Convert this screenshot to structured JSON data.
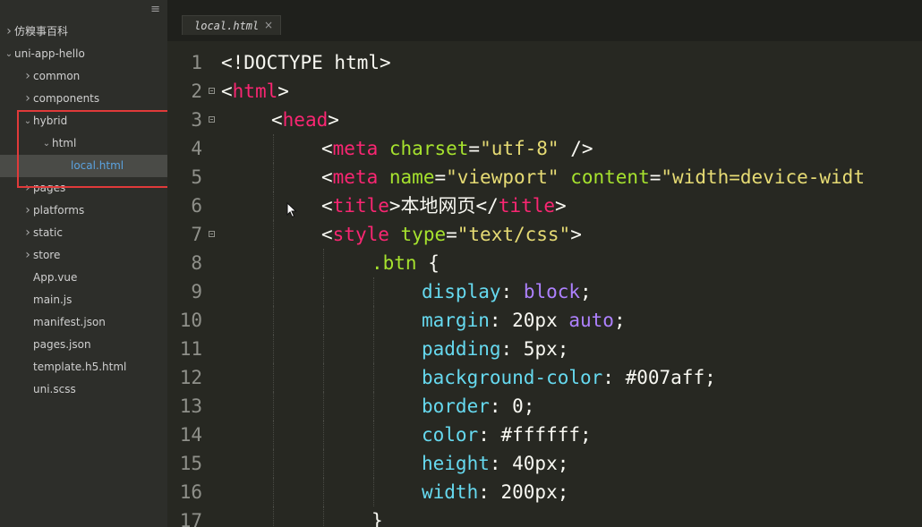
{
  "sidebar": {
    "menu_glyph": "≡",
    "items": [
      {
        "label": "仿糗事百科",
        "depth": 0,
        "chevron": "right"
      },
      {
        "label": "uni-app-hello",
        "depth": 0,
        "chevron": "down"
      },
      {
        "label": "common",
        "depth": 1,
        "chevron": "right"
      },
      {
        "label": "components",
        "depth": 1,
        "chevron": "right"
      },
      {
        "label": "hybrid",
        "depth": 1,
        "chevron": "down"
      },
      {
        "label": "html",
        "depth": 2,
        "chevron": "down"
      },
      {
        "label": "local.html",
        "depth": 3,
        "chevron": "none",
        "selected": true
      },
      {
        "label": "pages",
        "depth": 1,
        "chevron": "right"
      },
      {
        "label": "platforms",
        "depth": 1,
        "chevron": "right"
      },
      {
        "label": "static",
        "depth": 1,
        "chevron": "right"
      },
      {
        "label": "store",
        "depth": 1,
        "chevron": "right"
      },
      {
        "label": "App.vue",
        "depth": 1,
        "chevron": "none"
      },
      {
        "label": "main.js",
        "depth": 1,
        "chevron": "none"
      },
      {
        "label": "manifest.json",
        "depth": 1,
        "chevron": "none"
      },
      {
        "label": "pages.json",
        "depth": 1,
        "chevron": "none"
      },
      {
        "label": "template.h5.html",
        "depth": 1,
        "chevron": "none"
      },
      {
        "label": "uni.scss",
        "depth": 1,
        "chevron": "none"
      }
    ]
  },
  "tab": {
    "label": "local.html",
    "close": "×"
  },
  "editor": {
    "lines": [
      {
        "n": "1",
        "fold": false,
        "indent": 0,
        "tokens": [
          [
            "punc",
            "<!DOCTYPE html>"
          ]
        ]
      },
      {
        "n": "2",
        "fold": true,
        "indent": 0,
        "tokens": [
          [
            "punc",
            "<"
          ],
          [
            "tag",
            "html"
          ],
          [
            "punc",
            ">"
          ]
        ]
      },
      {
        "n": "3",
        "fold": true,
        "indent": 1,
        "tokens": [
          [
            "punc",
            "<"
          ],
          [
            "tag",
            "head"
          ],
          [
            "punc",
            ">"
          ]
        ]
      },
      {
        "n": "4",
        "fold": false,
        "indent": 2,
        "tokens": [
          [
            "punc",
            "<"
          ],
          [
            "tag",
            "meta"
          ],
          [
            "punc",
            " "
          ],
          [
            "attr",
            "charset"
          ],
          [
            "punc",
            "="
          ],
          [
            "str",
            "\"utf-8\""
          ],
          [
            "punc",
            " />"
          ]
        ]
      },
      {
        "n": "5",
        "fold": false,
        "indent": 2,
        "tokens": [
          [
            "punc",
            "<"
          ],
          [
            "tag",
            "meta"
          ],
          [
            "punc",
            " "
          ],
          [
            "attr",
            "name"
          ],
          [
            "punc",
            "="
          ],
          [
            "str",
            "\"viewport\""
          ],
          [
            "punc",
            " "
          ],
          [
            "attr",
            "content"
          ],
          [
            "punc",
            "="
          ],
          [
            "str",
            "\"width=device-widt"
          ]
        ]
      },
      {
        "n": "6",
        "fold": false,
        "indent": 2,
        "tokens": [
          [
            "punc",
            "<"
          ],
          [
            "tag",
            "title"
          ],
          [
            "punc",
            ">"
          ],
          [
            "text",
            "本地网页"
          ],
          [
            "punc",
            "</"
          ],
          [
            "tag",
            "title"
          ],
          [
            "punc",
            ">"
          ]
        ]
      },
      {
        "n": "7",
        "fold": true,
        "indent": 2,
        "tokens": [
          [
            "punc",
            "<"
          ],
          [
            "tag",
            "style"
          ],
          [
            "punc",
            " "
          ],
          [
            "attr",
            "type"
          ],
          [
            "punc",
            "="
          ],
          [
            "str",
            "\"text/css\""
          ],
          [
            "punc",
            ">"
          ]
        ]
      },
      {
        "n": "8",
        "fold": false,
        "indent": 3,
        "tokens": [
          [
            "attr",
            ".btn"
          ],
          [
            "punc",
            " {"
          ]
        ]
      },
      {
        "n": "9",
        "fold": false,
        "indent": 4,
        "tokens": [
          [
            "prop",
            "display"
          ],
          [
            "punc",
            ": "
          ],
          [
            "kw",
            "block"
          ],
          [
            "punc",
            ";"
          ]
        ]
      },
      {
        "n": "10",
        "fold": false,
        "indent": 4,
        "tokens": [
          [
            "prop",
            "margin"
          ],
          [
            "punc",
            ": 20px "
          ],
          [
            "kw",
            "auto"
          ],
          [
            "punc",
            ";"
          ]
        ]
      },
      {
        "n": "11",
        "fold": false,
        "indent": 4,
        "tokens": [
          [
            "prop",
            "padding"
          ],
          [
            "punc",
            ": 5px;"
          ]
        ]
      },
      {
        "n": "12",
        "fold": false,
        "indent": 4,
        "tokens": [
          [
            "prop",
            "background-color"
          ],
          [
            "punc",
            ": #007aff;"
          ]
        ]
      },
      {
        "n": "13",
        "fold": false,
        "indent": 4,
        "tokens": [
          [
            "prop",
            "border"
          ],
          [
            "punc",
            ": 0;"
          ]
        ]
      },
      {
        "n": "14",
        "fold": false,
        "indent": 4,
        "tokens": [
          [
            "prop",
            "color"
          ],
          [
            "punc",
            ": #ffffff;"
          ]
        ]
      },
      {
        "n": "15",
        "fold": false,
        "indent": 4,
        "tokens": [
          [
            "prop",
            "height"
          ],
          [
            "punc",
            ": 40px;"
          ]
        ]
      },
      {
        "n": "16",
        "fold": false,
        "indent": 4,
        "tokens": [
          [
            "prop",
            "width"
          ],
          [
            "punc",
            ": 200px;"
          ]
        ]
      },
      {
        "n": "17",
        "fold": false,
        "indent": 3,
        "tokens": [
          [
            "punc",
            "}"
          ]
        ]
      }
    ]
  },
  "colors": {
    "editor_bg": "#272822",
    "sidebar_bg": "#2d2e2a",
    "tag": "#f92672",
    "attr": "#a6e22e",
    "string": "#e6db74",
    "property": "#66d9ef",
    "keyword": "#ae81ff",
    "highlight_box": "#e03a3a"
  }
}
